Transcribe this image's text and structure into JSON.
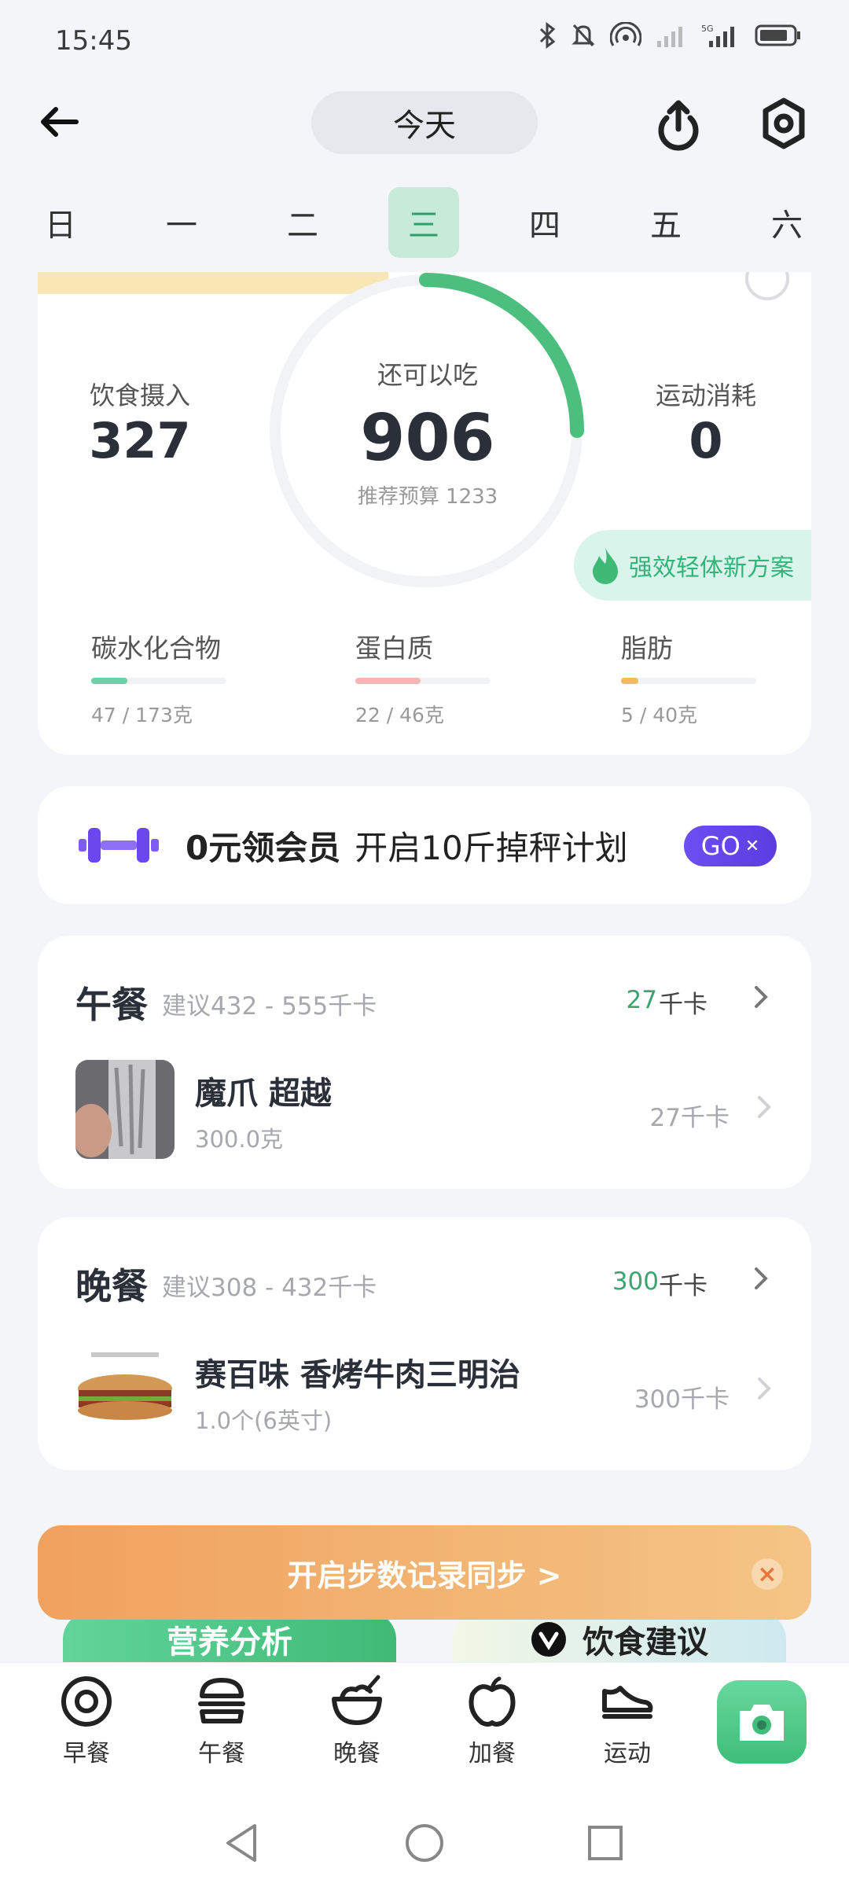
{
  "status_bar": {
    "time": "15:45"
  },
  "header": {
    "date_label": "今天"
  },
  "week": {
    "days": [
      "日",
      "一",
      "二",
      "三",
      "四",
      "五",
      "六"
    ],
    "active_index": 3
  },
  "summary": {
    "intake_label": "饮食摄入",
    "intake_value": "327",
    "remain_label": "还可以吃",
    "remain_value": "906",
    "budget_label": "推荐预算 1233",
    "burn_label": "运动消耗",
    "burn_value": "0",
    "plan_label": "强效轻体新方案",
    "macros": [
      {
        "name": "碳水化合物",
        "value": "47 / 173克",
        "fraction": 0.27,
        "color": "#6fd0a5"
      },
      {
        "name": "蛋白质",
        "value": "22 / 46克",
        "fraction": 0.48,
        "color": "#f4b7b3"
      },
      {
        "name": "脂肪",
        "value": "5 / 40克",
        "fraction": 0.125,
        "color": "#f0bd5e"
      }
    ]
  },
  "promo": {
    "text_bold": "0元领会员",
    "text": "开启10斤掉秤计划",
    "button_label": "GO"
  },
  "meals": {
    "lunch": {
      "title": "午餐",
      "suggestion": "建议432 - 555千卡",
      "kcal": "27",
      "unit": "千卡",
      "food": {
        "name": "魔爪 超越",
        "amount": "300.0克",
        "kcal": "27千卡"
      }
    },
    "dinner": {
      "title": "晚餐",
      "suggestion": "建议308 - 432千卡",
      "kcal": "300",
      "unit": "千卡",
      "food": {
        "name": "赛百味 香烤牛肉三明治",
        "amount": "1.0个(6英寸)",
        "kcal": "300千卡"
      }
    }
  },
  "banner": {
    "label": "开启步数记录同步 >",
    "close": "×"
  },
  "peek": {
    "nutrition": "营养分析",
    "advice": "饮食建议"
  },
  "bottom_nav": {
    "items": [
      {
        "label": "早餐",
        "icon": "breakfast-icon"
      },
      {
        "label": "午餐",
        "icon": "burger-icon"
      },
      {
        "label": "晚餐",
        "icon": "bowl-icon"
      },
      {
        "label": "加餐",
        "icon": "apple-icon"
      },
      {
        "label": "运动",
        "icon": "shoe-icon"
      }
    ],
    "camera_icon": "camera-icon"
  },
  "colors": {
    "accent_green": "#3fba76",
    "promo_purple": "#6c4ff2",
    "banner_orange": "#f1a15e"
  }
}
